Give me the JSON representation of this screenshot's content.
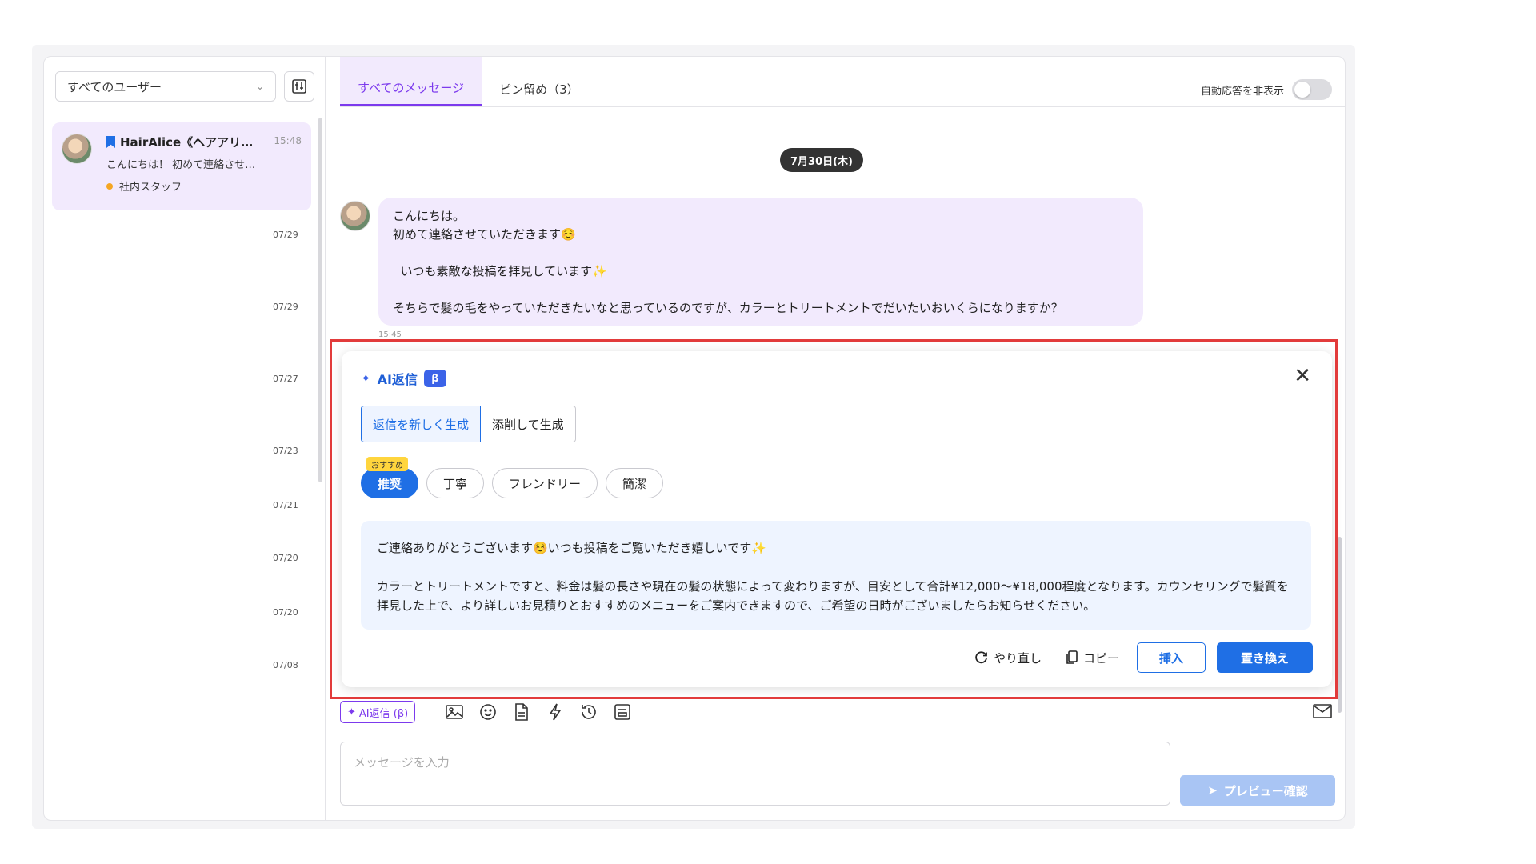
{
  "sidebar": {
    "user_filter": "すべてのユーザー",
    "conversations": [
      {
        "name": "HairAlice《ヘアアリ…",
        "time": "15:48",
        "preview": "こんにちは！ 初めて連絡させ…",
        "tag": "社内スタッフ"
      }
    ],
    "dates": [
      "07/29",
      "07/29",
      "07/27",
      "07/23",
      "07/21",
      "07/20",
      "07/20",
      "07/08"
    ]
  },
  "header": {
    "tabs": [
      {
        "label": "すべてのメッセージ"
      },
      {
        "label": "ピン留め（3）"
      }
    ],
    "auto_reply_label": "自動応答を非表示"
  },
  "chat": {
    "date_pill": "7月30日(木)",
    "message_lines": [
      "こんにちは。",
      "初めて連絡させていただきます☺️",
      "",
      "  いつも素敵な投稿を拝見しています✨",
      "",
      "そちらで髪の毛をやっていただきたいなと思っているのですが、カラーとトリートメントでだいたいおいくらになりますか？"
    ],
    "time": "15:45"
  },
  "ai_panel": {
    "title": "AI返信",
    "beta": "β",
    "modes": [
      "返信を新しく生成",
      "添削して生成"
    ],
    "recommend_badge": "おすすめ",
    "tones": [
      "推奨",
      "丁寧",
      "フレンドリー",
      "簡潔"
    ],
    "result_p1": "ご連絡ありがとうございます☺️いつも投稿をご覧いただき嬉しいです✨",
    "result_p2": "カラーとトリートメントですと、料金は髪の長さや現在の髪の状態によって変わりますが、目安として合計¥12,000〜¥18,000程度となります。カウンセリングで髪質を拝見した上で、より詳しいお見積りとおすすめのメニューをご案内できますので、ご希望の日時がございましたらお知らせください。",
    "retry": "やり直し",
    "copy": "コピー",
    "insert": "挿入",
    "replace": "置き換え"
  },
  "compose": {
    "ai_chip": "AI返信 (β)",
    "placeholder": "メッセージを入力",
    "preview_button": "プレビュー確認"
  },
  "colors": {
    "accent": "#7c3aed",
    "primary": "#1f6fe5",
    "highlight": "#e23b3b"
  }
}
